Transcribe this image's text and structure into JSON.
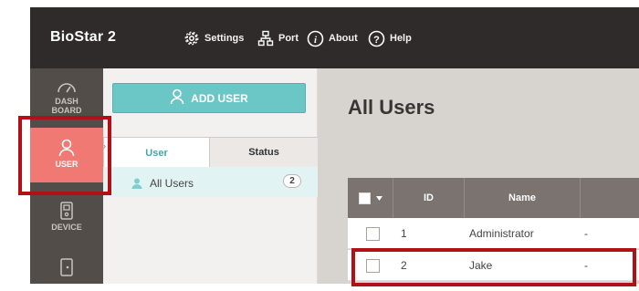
{
  "header": {
    "app_title": "BioStar 2",
    "menu": [
      {
        "label": "Settings",
        "icon": "gear-icon"
      },
      {
        "label": "Port",
        "icon": "network-icon"
      },
      {
        "label": "About",
        "icon": "info-icon"
      },
      {
        "label": "Help",
        "icon": "help-icon"
      }
    ]
  },
  "nav": {
    "items": [
      {
        "label": "DASH BOARD",
        "icon": "speedometer-icon"
      },
      {
        "label": "USER",
        "icon": "user-icon",
        "active": true
      },
      {
        "label": "DEVICE",
        "icon": "device-icon"
      },
      {
        "label": "",
        "icon": "door-icon"
      }
    ]
  },
  "panel": {
    "add_user_label": "ADD USER",
    "tabs": [
      {
        "label": "User",
        "active": true
      },
      {
        "label": "Status"
      }
    ],
    "tree": {
      "label": "All Users",
      "count": "2"
    }
  },
  "main": {
    "title": "All Users",
    "table": {
      "columns": [
        "ID",
        "Name"
      ],
      "rows": [
        {
          "id": "1",
          "name": "Administrator",
          "extra": "-"
        },
        {
          "id": "2",
          "name": "Jake",
          "extra": "-"
        }
      ]
    }
  },
  "colors": {
    "topbar": "#2f2b2a",
    "nav": "#534d4a",
    "nav_active": "#f07a73",
    "accent": "#6ac7c6",
    "table_header": "#7a7370",
    "highlight": "#b30f16"
  }
}
